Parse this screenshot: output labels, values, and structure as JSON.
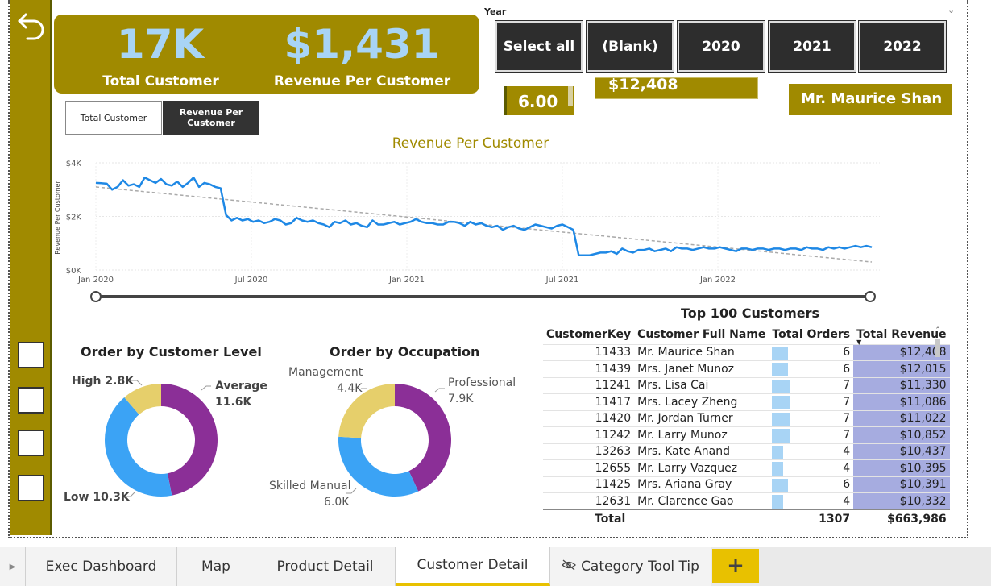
{
  "kpi": {
    "total_customer_value": "17K",
    "total_customer_label": "Total Customer",
    "revenue_per_customer_value": "$1,431",
    "revenue_per_customer_label": "Revenue Per Customer"
  },
  "toggle": {
    "total_customer": "Total Customer",
    "revenue_per_customer": "Revenue Per Customer"
  },
  "year_slicer": {
    "label": "Year",
    "options": [
      "Select all",
      "(Blank)",
      "2020",
      "2021",
      "2022"
    ]
  },
  "cards": {
    "orders": "6.00",
    "revenue": "$12,408",
    "customer": "Mr. Maurice Shan"
  },
  "line_chart_data": {
    "type": "line",
    "title": "Revenue Per Customer",
    "ylabel": "Revenue Per Customer",
    "y_ticks": [
      "$4K",
      "$2K",
      "$0K"
    ],
    "x_ticks": [
      "Jan 2020",
      "Jul 2020",
      "Jan 2021",
      "Jul 2021",
      "Jan 2022"
    ],
    "ylim": [
      0,
      4000
    ],
    "color": "#1e88e5",
    "trend_color": "#aaaaaa",
    "values": [
      3250,
      3240,
      3220,
      3000,
      3100,
      3350,
      3150,
      3200,
      3100,
      3450,
      3350,
      3250,
      3400,
      3200,
      3150,
      3300,
      3100,
      3250,
      3450,
      3100,
      3250,
      3200,
      3100,
      3050,
      2050,
      1850,
      1950,
      1850,
      1900,
      1800,
      1850,
      1750,
      1800,
      1900,
      1850,
      1700,
      1750,
      1950,
      1850,
      1800,
      1850,
      1750,
      1700,
      1600,
      1800,
      1750,
      1850,
      1700,
      1750,
      1650,
      1600,
      1850,
      1700,
      1700,
      1750,
      1800,
      1700,
      1750,
      1800,
      1900,
      1800,
      1750,
      1750,
      1700,
      1700,
      1800,
      1800,
      1750,
      1650,
      1800,
      1700,
      1750,
      1650,
      1600,
      1650,
      1500,
      1600,
      1650,
      1550,
      1500,
      1600,
      1700,
      1650,
      1600,
      1550,
      1650,
      1700,
      1600,
      1500,
      550,
      550,
      550,
      600,
      650,
      650,
      700,
      600,
      800,
      700,
      650,
      750,
      750,
      800,
      700,
      750,
      800,
      700,
      850,
      800,
      800,
      750,
      800,
      850,
      800,
      800,
      850,
      800,
      750,
      700,
      800,
      800,
      750,
      800,
      800,
      750,
      800,
      800,
      750,
      800,
      800,
      750,
      850,
      800,
      800,
      750,
      850,
      800,
      850,
      800,
      850,
      900,
      850,
      900,
      850
    ],
    "trend": [
      3100,
      300
    ]
  },
  "customer_level": {
    "title": "Order by Customer Level",
    "slices": [
      {
        "name": "Average",
        "label": "Average",
        "value_label": "11.6K",
        "value": 11.6,
        "color": "#8b2f97"
      },
      {
        "name": "Low",
        "label": "Low 10.3K",
        "value": 10.3,
        "color": "#3ba3f5"
      },
      {
        "name": "High",
        "label": "High 2.8K",
        "value": 2.8,
        "color": "#e6cf6b"
      }
    ]
  },
  "occupation": {
    "title": "Order by Occupation",
    "slices": [
      {
        "name": "Professional",
        "label": "Professional",
        "value_label": "7.9K",
        "value": 7.9,
        "color": "#8b2f97"
      },
      {
        "name": "Skilled Manual",
        "label": "Skilled Manual",
        "value_label": "6.0K",
        "value": 6.0,
        "color": "#3ba3f5"
      },
      {
        "name": "Management",
        "label": "Management",
        "value_label": "4.4K",
        "value": 4.4,
        "color": "#e6cf6b"
      }
    ]
  },
  "top_customers": {
    "title": "Top 100 Customers",
    "columns": [
      "CustomerKey",
      "Customer Full Name",
      "Total Orders",
      "Total Revenue"
    ],
    "rows": [
      {
        "key": "11433",
        "name": "Mr. Maurice Shan",
        "orders": 6,
        "revenue": "$12,408"
      },
      {
        "key": "11439",
        "name": "Mrs. Janet Munoz",
        "orders": 6,
        "revenue": "$12,015"
      },
      {
        "key": "11241",
        "name": "Mrs. Lisa Cai",
        "orders": 7,
        "revenue": "$11,330"
      },
      {
        "key": "11417",
        "name": "Mrs. Lacey Zheng",
        "orders": 7,
        "revenue": "$11,086"
      },
      {
        "key": "11420",
        "name": "Mr. Jordan Turner",
        "orders": 7,
        "revenue": "$11,022"
      },
      {
        "key": "11242",
        "name": "Mr. Larry Munoz",
        "orders": 7,
        "revenue": "$10,852"
      },
      {
        "key": "13263",
        "name": "Mrs. Kate Anand",
        "orders": 4,
        "revenue": "$10,437"
      },
      {
        "key": "12655",
        "name": "Mr. Larry Vazquez",
        "orders": 4,
        "revenue": "$10,395"
      },
      {
        "key": "11425",
        "name": "Mrs. Ariana Gray",
        "orders": 6,
        "revenue": "$10,391"
      },
      {
        "key": "12631",
        "name": "Mr. Clarence Gao",
        "orders": 4,
        "revenue": "$10,332"
      }
    ],
    "total_label": "Total",
    "total_orders": "1307",
    "total_revenue": "$663,986"
  },
  "tabs": [
    "Exec Dashboard",
    "Map",
    "Product Detail",
    "Customer Detail",
    "Category Tool Tip"
  ],
  "active_tab": "Customer Detail"
}
